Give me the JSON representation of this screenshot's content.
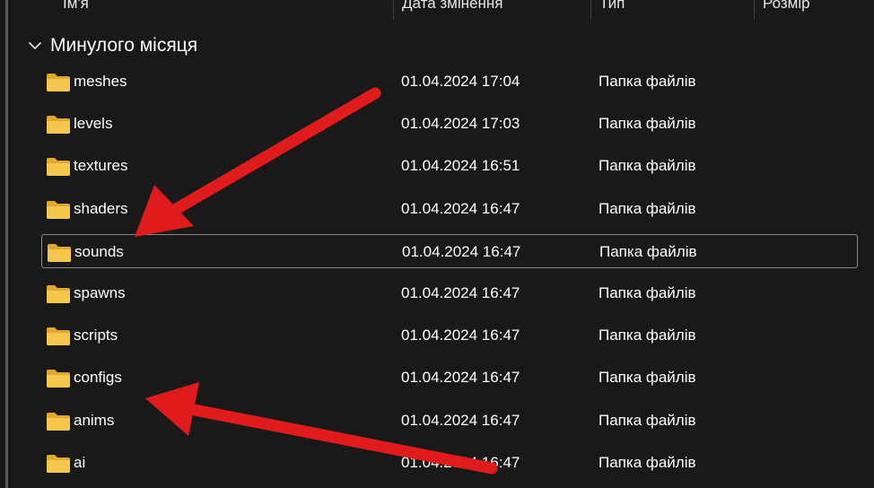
{
  "columns": {
    "name": "Ім'я",
    "date": "Дата змінення",
    "type": "Тип",
    "size": "Розмір"
  },
  "group": {
    "label": "Минулого місяця",
    "icon": "chevron-down-icon"
  },
  "rows": [
    {
      "name": "meshes",
      "date": "01.04.2024 17:04",
      "type": "Папка файлів"
    },
    {
      "name": "levels",
      "date": "01.04.2024 17:03",
      "type": "Папка файлів"
    },
    {
      "name": "textures",
      "date": "01.04.2024 16:51",
      "type": "Папка файлів"
    },
    {
      "name": "shaders",
      "date": "01.04.2024 16:47",
      "type": "Папка файлів"
    },
    {
      "name": "sounds",
      "date": "01.04.2024 16:47",
      "type": "Папка файлів",
      "selected": true
    },
    {
      "name": "spawns",
      "date": "01.04.2024 16:47",
      "type": "Папка файлів"
    },
    {
      "name": "scripts",
      "date": "01.04.2024 16:47",
      "type": "Папка файлів"
    },
    {
      "name": "configs",
      "date": "01.04.2024 16:47",
      "type": "Папка файлів"
    },
    {
      "name": "anims",
      "date": "01.04.2024 16:47",
      "type": "Папка файлів"
    },
    {
      "name": "ai",
      "date": "01.04.2024 16:47",
      "type": "Папка файлів"
    }
  ],
  "colors": {
    "background": "#191919",
    "folder": "#f6c74d",
    "folder_dark": "#e0a82c",
    "annotation_arrow": "#e01b1b",
    "selection_border": "#8a8a8a"
  }
}
